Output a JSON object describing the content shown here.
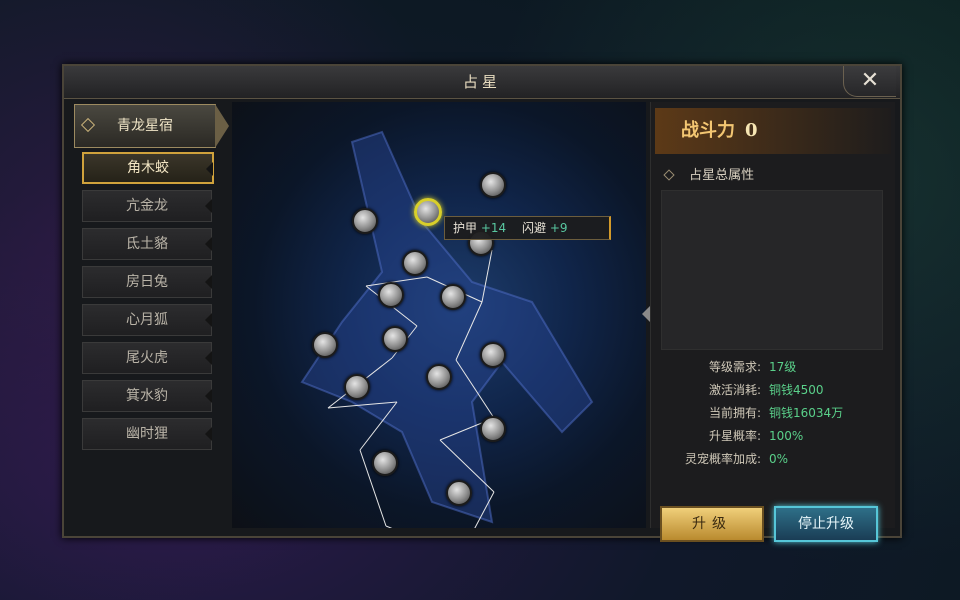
{
  "window": {
    "title": "占星",
    "close_label": "✕"
  },
  "sidebar": {
    "header": "青龙星宿",
    "items": [
      "角木蛟",
      "亢金龙",
      "氐土貉",
      "房日兔",
      "心月狐",
      "尾火虎",
      "箕水豹",
      "幽时狸"
    ],
    "selected_index": 0
  },
  "board": {
    "tooltip": {
      "label1": "护甲",
      "value1": "+14",
      "label2": "闪避",
      "value2": "+9"
    }
  },
  "panel": {
    "power_label": "战斗力",
    "power_value": "0",
    "attr_title": "占星总属性",
    "level_req_label": "等级需求:",
    "level_req_value": "17级",
    "activate_cost_label": "激活消耗:",
    "activate_cost_value": "铜钱4500",
    "current_own_label": "当前拥有:",
    "current_own_value": "铜钱16034万",
    "upgrade_rate_label": "升星概率:",
    "upgrade_rate_value": "100%",
    "pet_rate_label": "灵宠概率加成:",
    "pet_rate_value": "0%"
  },
  "buttons": {
    "upgrade": "升级",
    "stop": "停止升级"
  },
  "colors": {
    "gold": "#d0a23c",
    "green": "#5ad08a",
    "select_ring": "#d8cf2a"
  }
}
